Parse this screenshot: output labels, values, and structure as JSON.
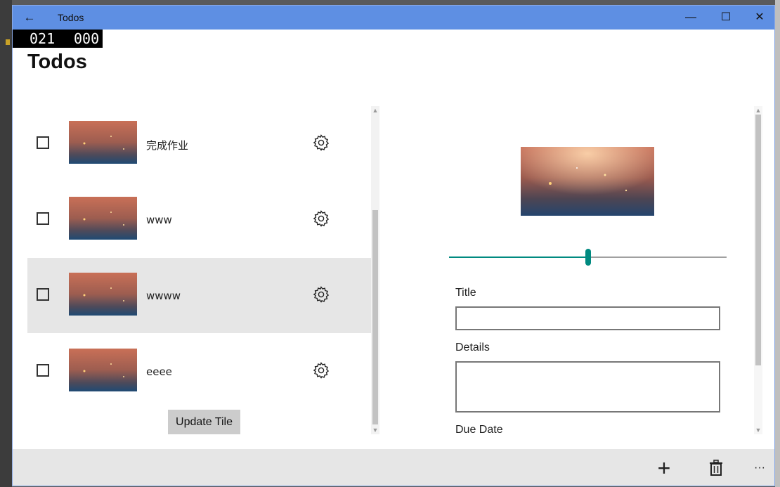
{
  "window": {
    "title": "Todos",
    "controls": {
      "back_icon": "←",
      "minimize": "—",
      "maximize": "☐",
      "close": "✕"
    }
  },
  "counter": {
    "left": "021",
    "right": "000"
  },
  "page": {
    "title": "Todos"
  },
  "todos": [
    {
      "title": "完成作业",
      "checked": false,
      "selected": false
    },
    {
      "title": "www",
      "checked": false,
      "selected": false
    },
    {
      "title": "wwww",
      "checked": false,
      "selected": true
    },
    {
      "title": "eeee",
      "checked": false,
      "selected": false
    }
  ],
  "update_tile_label": "Update Tile",
  "detail": {
    "slider_fraction": 0.5,
    "title_label": "Title",
    "title_value": "",
    "details_label": "Details",
    "details_value": "",
    "due_date_label": "Due Date"
  },
  "commandbar": {
    "add_icon": "+",
    "delete_icon": "trash-icon",
    "more_icon": "···"
  },
  "colors": {
    "titlebar": "#5e8fe3",
    "accent": "#008a80",
    "selected_row": "#e6e6e6",
    "commandbar": "#e6e6e6"
  }
}
